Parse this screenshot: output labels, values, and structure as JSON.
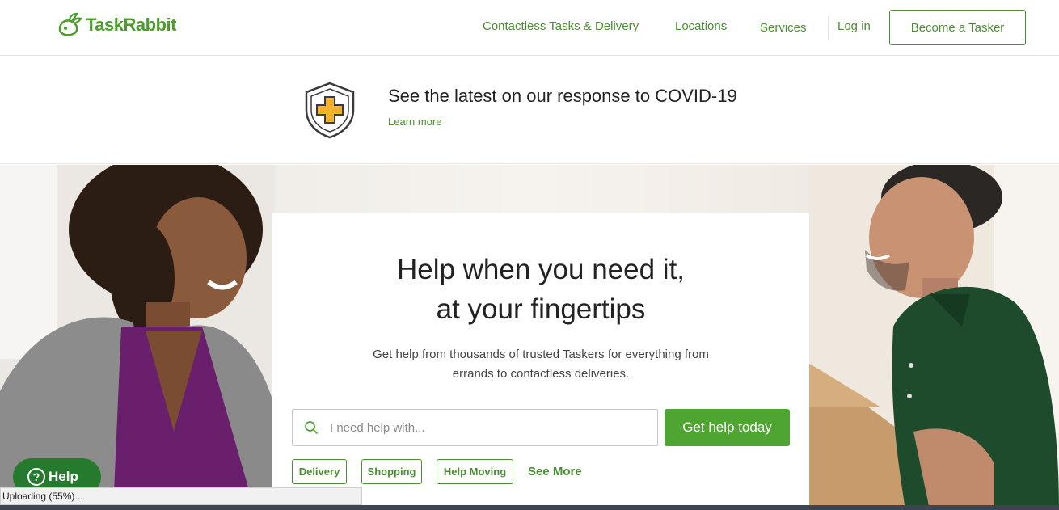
{
  "header": {
    "logo_text": "TaskRabbit",
    "nav": [
      {
        "label": "Contactless Tasks & Delivery"
      },
      {
        "label": "Locations"
      },
      {
        "label": "Services"
      },
      {
        "label": "Log in"
      }
    ],
    "become_tasker_label": "Become a Tasker"
  },
  "banner": {
    "title": "See the latest on our response to COVID-19",
    "link": "Learn more",
    "icon": "shield-plus-icon"
  },
  "hero": {
    "title_line1": "Help when you need it,",
    "title_line2": "at your fingertips",
    "subtitle_line1": "Get help from thousands of trusted Taskers for everything from",
    "subtitle_line2": "errands to contactless deliveries.",
    "search_placeholder": "I need help with...",
    "cta_label": "Get help today",
    "chips": [
      "Delivery",
      "Shopping",
      "Help Moving"
    ],
    "see_more": "See More"
  },
  "help": {
    "label": "Help"
  },
  "status": {
    "text": "Uploading (55%)..."
  },
  "colors": {
    "brand_green": "#4a8e33",
    "cta_green": "#4ea532",
    "help_green": "#267a2e",
    "shield_yellow": "#f2b22a"
  }
}
